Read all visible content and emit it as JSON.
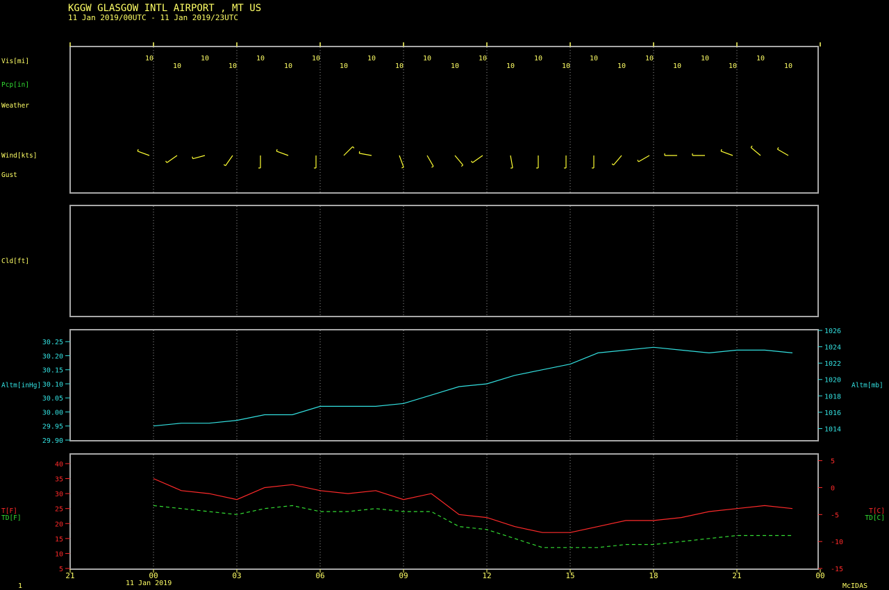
{
  "header": {
    "title": "KGGW  GLASGOW INTL AIRPORT , MT US",
    "subtitle": "11 Jan 2019/00UTC - 11 Jan 2019/23UTC"
  },
  "footer": {
    "page_number": "1",
    "date_label": "11 Jan 2019",
    "software": "McIDAS"
  },
  "colors": {
    "background": "#000000",
    "frame": "#a8a8a8",
    "text_yellow": "#ffff66",
    "cyan": "#33e0e0",
    "green": "#33dd33",
    "red": "#ff2a2a",
    "wind": "#ffff33"
  },
  "panel_labels": {
    "visibility": "Vis[mi]",
    "precip": "Pcp[in]",
    "weather": "Weather",
    "wind": "Wind[kts]",
    "gust": "Gust",
    "cloud": "Cld[ft]",
    "alt_left": "Altm[inHg]",
    "alt_right": "Altm[mb]",
    "temp_f": "T[F]",
    "dew_f": "TD[F]",
    "temp_c": "T[C]",
    "dew_c": "TD[C]"
  },
  "chart_data": [
    {
      "type": "table",
      "name": "surface observations",
      "x_hours": [
        0,
        1,
        2,
        3,
        4,
        5,
        6,
        7,
        8,
        9,
        10,
        11,
        12,
        13,
        14,
        15,
        16,
        17,
        18,
        19,
        20,
        21,
        22,
        23
      ],
      "visibility_mi": [
        "10",
        "10",
        "10",
        "10",
        "10",
        "10",
        "10",
        "10",
        "10",
        "10",
        "10",
        "10",
        "10",
        "10",
        "10",
        "10",
        "10",
        "10",
        "10",
        "10",
        "10",
        "10",
        "10",
        "10"
      ],
      "wind_barbs": [
        {
          "dir": 290,
          "speed": 7
        },
        {
          "dir": 235,
          "speed": 7
        },
        {
          "dir": 255,
          "speed": 6
        },
        {
          "dir": 215,
          "speed": 5
        },
        {
          "dir": 180,
          "speed": 5
        },
        {
          "dir": 290,
          "speed": 6
        },
        {
          "dir": 180,
          "speed": 5
        },
        {
          "dir": 45,
          "speed": 6
        },
        {
          "dir": 280,
          "speed": 5
        },
        {
          "dir": 160,
          "speed": 5
        },
        {
          "dir": 150,
          "speed": 5
        },
        {
          "dir": 140,
          "speed": 5
        },
        {
          "dir": 235,
          "speed": 6
        },
        {
          "dir": 170,
          "speed": 5
        },
        {
          "dir": 180,
          "speed": 5
        },
        {
          "dir": 180,
          "speed": 5
        },
        {
          "dir": 180,
          "speed": 5
        },
        {
          "dir": 220,
          "speed": 6
        },
        {
          "dir": 240,
          "speed": 6
        },
        {
          "dir": 270,
          "speed": 6
        },
        {
          "dir": 270,
          "speed": 6
        },
        {
          "dir": 290,
          "speed": 6
        },
        {
          "dir": 310,
          "speed": 7
        },
        {
          "dir": 300,
          "speed": 7
        }
      ]
    },
    {
      "type": "line",
      "name": "altimeter",
      "x_hours": [
        0,
        1,
        2,
        3,
        4,
        5,
        6,
        7,
        8,
        9,
        10,
        11,
        12,
        13,
        14,
        15,
        16,
        17,
        18,
        19,
        20,
        21,
        22,
        23
      ],
      "series": [
        {
          "name": "Altm[inHg]",
          "values": [
            29.95,
            29.96,
            29.96,
            29.97,
            29.99,
            29.99,
            30.02,
            30.02,
            30.02,
            30.03,
            30.06,
            30.09,
            30.1,
            30.13,
            30.15,
            30.17,
            30.21,
            30.22,
            30.23,
            30.22,
            30.21,
            30.22,
            30.22,
            30.21
          ]
        }
      ],
      "ylim": [
        29.9,
        30.29
      ],
      "y_ticks": [
        "29.90",
        "30.00",
        "30.05",
        "30.10",
        "30.15",
        "30.20",
        "30.25"
      ],
      "y_ticks_major": [
        "29.95"
      ],
      "ylim_right_mb": [
        1012.6,
        1026
      ],
      "y_ticks_right": [
        "1014",
        "1016",
        "1018",
        "1020",
        "1022",
        "1024",
        "1026"
      ]
    },
    {
      "type": "line",
      "name": "temperature and dewpoint",
      "x_hours": [
        0,
        1,
        2,
        3,
        4,
        5,
        6,
        7,
        8,
        9,
        10,
        11,
        12,
        13,
        14,
        15,
        16,
        17,
        18,
        19,
        20,
        21,
        22,
        23
      ],
      "series": [
        {
          "name": "T[F]",
          "values": [
            35,
            31,
            30,
            28,
            32,
            33,
            31,
            30,
            31,
            28,
            30,
            23,
            22,
            19,
            17,
            17,
            19,
            21,
            21,
            22,
            24,
            25,
            26,
            25
          ]
        },
        {
          "name": "TD[F]",
          "values": [
            26,
            25,
            24,
            23,
            25,
            26,
            24,
            24,
            25,
            24,
            24,
            19,
            18,
            15,
            12,
            12,
            12,
            13,
            13,
            14,
            15,
            16,
            16,
            16
          ]
        }
      ],
      "ylim": [
        5,
        43
      ],
      "y_ticks": [
        "5",
        "10",
        "15",
        "20",
        "25",
        "30",
        "35",
        "40"
      ],
      "y_ticks_right": [
        "5",
        "0",
        "-5",
        "-10",
        "-15"
      ],
      "x_tick_labels": [
        "21",
        "00",
        "03",
        "06",
        "09",
        "12",
        "15",
        "18",
        "21",
        "00"
      ]
    }
  ]
}
